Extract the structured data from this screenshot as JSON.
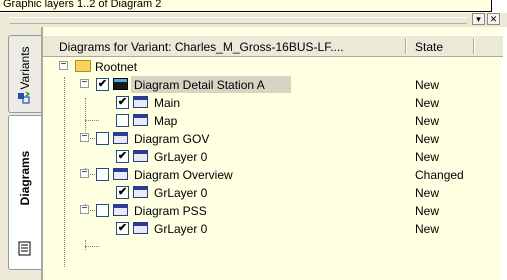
{
  "tooltip": "Graphic layers 1..2 of Diagram 2",
  "window": {
    "pin_glyph": "▾",
    "close_glyph": "✕"
  },
  "tabs": [
    {
      "label": "Variants"
    },
    {
      "label": "Diagrams"
    }
  ],
  "columns": {
    "name": "Diagrams for Variant: Charles_M_Gross-16BUS-LF....",
    "state": "State"
  },
  "tree": {
    "root": "Rootnet",
    "rows": [
      {
        "label": "Diagram Detail Station A",
        "state": "New",
        "checked": true
      },
      {
        "label": "Main",
        "state": "New",
        "checked": true
      },
      {
        "label": "Map",
        "state": "New",
        "checked": false
      },
      {
        "label": "Diagram GOV",
        "state": "New",
        "checked": false
      },
      {
        "label": "GrLayer 0",
        "state": "New",
        "checked": true
      },
      {
        "label": "Diagram Overview",
        "state": "Changed",
        "checked": false
      },
      {
        "label": "GrLayer 0",
        "state": "New",
        "checked": true
      },
      {
        "label": "Diagram PSS",
        "state": "New",
        "checked": false
      },
      {
        "label": "GrLayer 0",
        "state": "New",
        "checked": true
      }
    ]
  },
  "marks": {
    "checked": "✔",
    "collapse": "−"
  }
}
